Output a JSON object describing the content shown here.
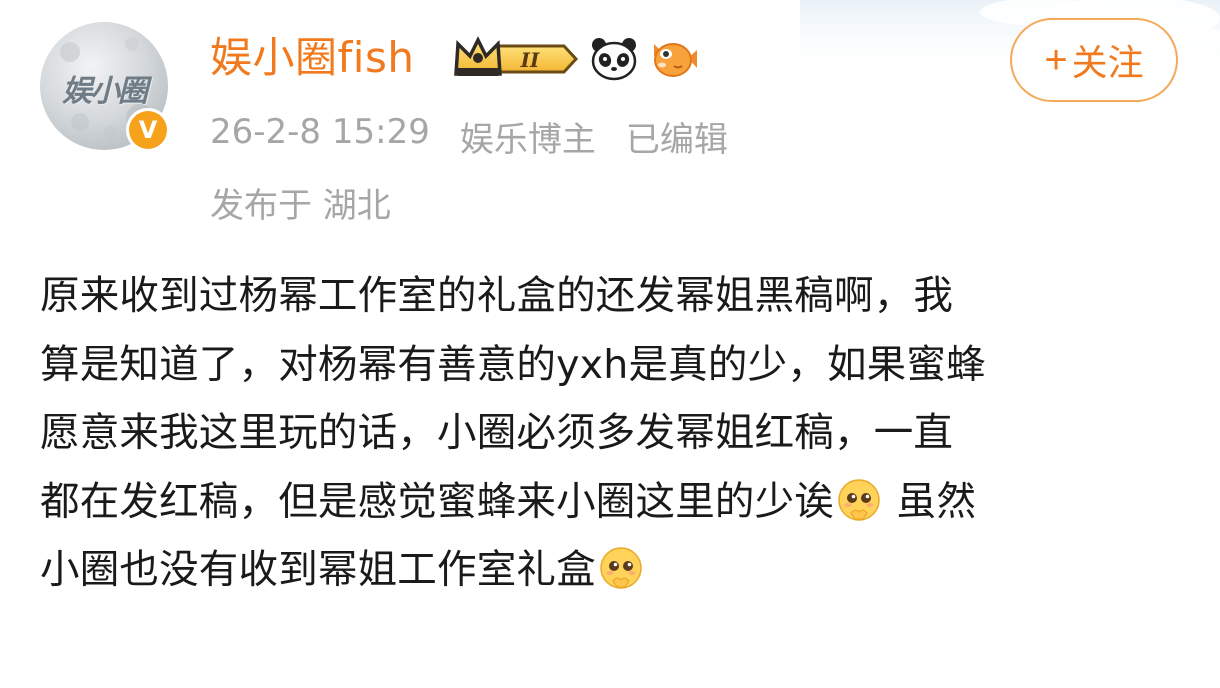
{
  "post": {
    "author": {
      "name": "娱小圈fish",
      "avatar_text": "娱小圈",
      "verified_mark": "V",
      "vip_level": "II"
    },
    "follow_button": {
      "plus": "+",
      "label": "关注"
    },
    "meta": {
      "timestamp": "26-2-8 15:29",
      "role": "娱乐博主",
      "edited": "已编辑",
      "location": "发布于 湖北"
    },
    "content": {
      "line1": "原来收到过杨幂工作室的礼盒的还发幂姐黑稿啊，我",
      "line2": "算是知道了，对杨幂有善意的yxh是真的少，如果蜜蜂",
      "line3": "愿意来我这里玩的话，小圈必须多发幂姐红稿，一直",
      "line4a": "都在发红稿，但是感觉蜜蜂来小圈这里的少诶",
      "line4b": " 虽然",
      "line5": "小圈也没有收到幂姐工作室礼盒"
    }
  },
  "colors": {
    "accent": "#f07a1d",
    "meta_gray": "#a6a6a6",
    "text": "#1a1a1a",
    "verified": "#f6a21a"
  },
  "icons": [
    "crown-vip-badge-icon",
    "panda-icon",
    "fish-icon",
    "verified-v-icon",
    "pleading-face-emoji-icon"
  ]
}
